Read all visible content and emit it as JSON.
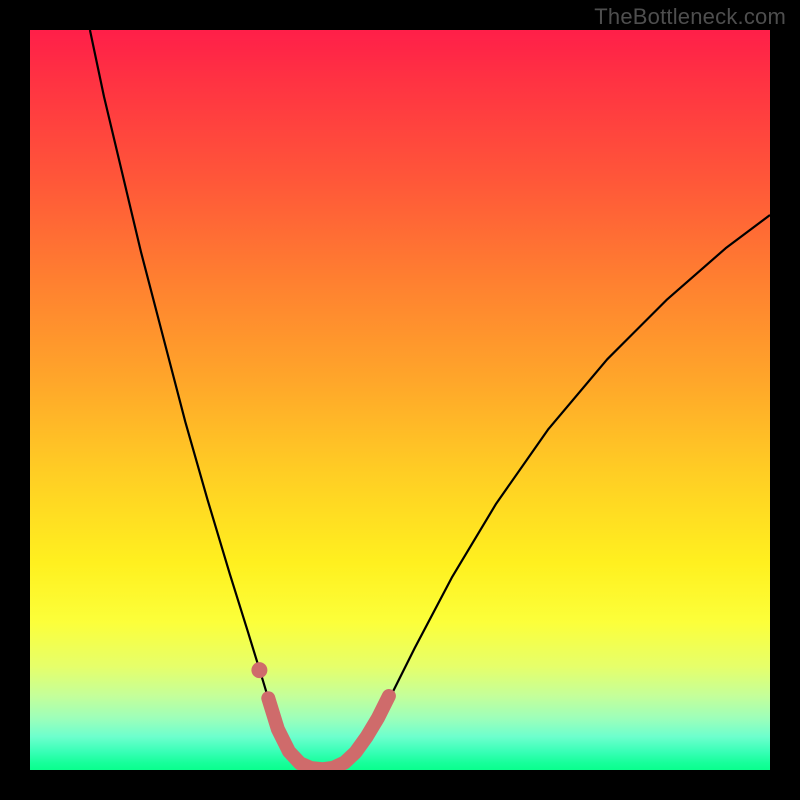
{
  "watermark": "TheBottleneck.com",
  "chart_data": {
    "type": "line",
    "title": "",
    "xlabel": "",
    "ylabel": "",
    "xlim": [
      0,
      100
    ],
    "ylim": [
      0,
      100
    ],
    "gradient_stops": [
      {
        "pct": 0,
        "color": "#ff1f49"
      },
      {
        "pct": 6,
        "color": "#ff3043"
      },
      {
        "pct": 20,
        "color": "#ff5639"
      },
      {
        "pct": 34,
        "color": "#ff8030"
      },
      {
        "pct": 47,
        "color": "#ffa52a"
      },
      {
        "pct": 60,
        "color": "#ffce24"
      },
      {
        "pct": 72,
        "color": "#fff01f"
      },
      {
        "pct": 80,
        "color": "#fcff3a"
      },
      {
        "pct": 86,
        "color": "#e6ff6a"
      },
      {
        "pct": 90,
        "color": "#c4ff9a"
      },
      {
        "pct": 93,
        "color": "#9dffba"
      },
      {
        "pct": 95.5,
        "color": "#6dffcd"
      },
      {
        "pct": 97.5,
        "color": "#39ffb7"
      },
      {
        "pct": 99,
        "color": "#17ff9b"
      },
      {
        "pct": 100,
        "color": "#0aff8d"
      }
    ],
    "series": [
      {
        "name": "black-curve-left",
        "color": "#000000",
        "width": 2.2,
        "points": [
          {
            "x": 8.1,
            "y": 100.0
          },
          {
            "x": 10.0,
            "y": 91.0
          },
          {
            "x": 12.5,
            "y": 80.5
          },
          {
            "x": 15.0,
            "y": 70.0
          },
          {
            "x": 18.0,
            "y": 58.5
          },
          {
            "x": 21.0,
            "y": 47.0
          },
          {
            "x": 24.0,
            "y": 36.5
          },
          {
            "x": 27.0,
            "y": 26.5
          },
          {
            "x": 29.5,
            "y": 18.5
          },
          {
            "x": 31.5,
            "y": 12.0
          },
          {
            "x": 33.0,
            "y": 7.0
          },
          {
            "x": 34.5,
            "y": 3.5
          },
          {
            "x": 36.0,
            "y": 1.3
          },
          {
            "x": 37.5,
            "y": 0.3
          },
          {
            "x": 39.0,
            "y": 0.0
          }
        ]
      },
      {
        "name": "black-curve-right",
        "color": "#000000",
        "width": 2.2,
        "points": [
          {
            "x": 39.0,
            "y": 0.0
          },
          {
            "x": 41.0,
            "y": 0.2
          },
          {
            "x": 43.0,
            "y": 1.2
          },
          {
            "x": 45.0,
            "y": 3.5
          },
          {
            "x": 48.0,
            "y": 8.5
          },
          {
            "x": 52.0,
            "y": 16.5
          },
          {
            "x": 57.0,
            "y": 26.0
          },
          {
            "x": 63.0,
            "y": 36.0
          },
          {
            "x": 70.0,
            "y": 46.0
          },
          {
            "x": 78.0,
            "y": 55.5
          },
          {
            "x": 86.0,
            "y": 63.5
          },
          {
            "x": 94.0,
            "y": 70.5
          },
          {
            "x": 100.0,
            "y": 75.0
          }
        ]
      },
      {
        "name": "pink-marker-dot",
        "color": "#cf6b6b",
        "type": "scatter",
        "points": [
          {
            "x": 31.0,
            "y": 13.5
          }
        ]
      },
      {
        "name": "pink-highlight-band",
        "color": "#cf6b6b",
        "width": 14,
        "points": [
          {
            "x": 32.2,
            "y": 9.7
          },
          {
            "x": 33.5,
            "y": 5.5
          },
          {
            "x": 35.0,
            "y": 2.5
          },
          {
            "x": 36.5,
            "y": 0.9
          },
          {
            "x": 38.0,
            "y": 0.25
          },
          {
            "x": 39.5,
            "y": 0.1
          },
          {
            "x": 41.0,
            "y": 0.3
          },
          {
            "x": 42.5,
            "y": 1.0
          },
          {
            "x": 44.0,
            "y": 2.4
          },
          {
            "x": 45.5,
            "y": 4.5
          },
          {
            "x": 47.0,
            "y": 7.0
          },
          {
            "x": 48.5,
            "y": 10.0
          }
        ]
      }
    ]
  }
}
